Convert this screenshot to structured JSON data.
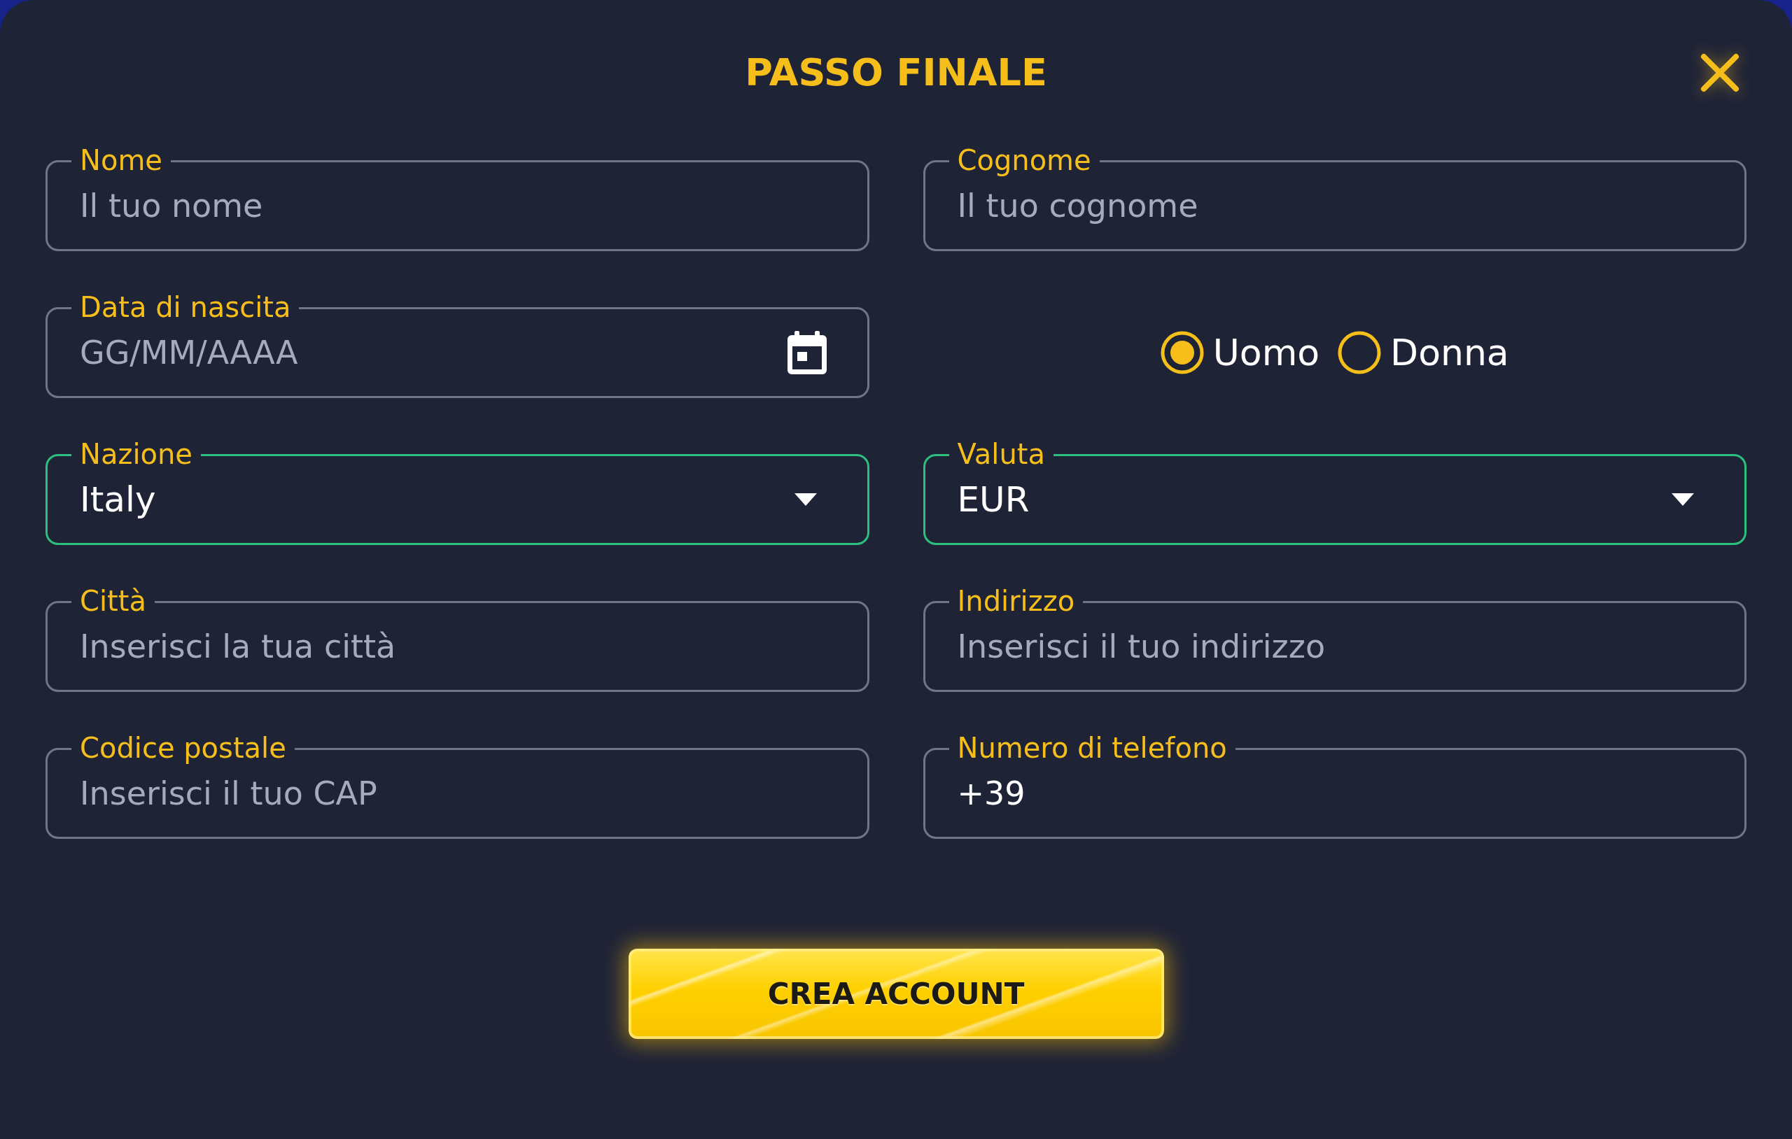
{
  "dialog": {
    "title": "PASSO FINALE"
  },
  "fields": [
    {
      "kind": "text",
      "label": "Nome",
      "placeholder": "Il tuo nome",
      "valid": false
    },
    {
      "kind": "text",
      "label": "Cognome",
      "placeholder": "Il tuo cognome",
      "valid": false
    },
    {
      "kind": "date",
      "label": "Data di nascita",
      "placeholder": "GG/MM/AAAA",
      "valid": false
    },
    {
      "kind": "radio",
      "options": [
        {
          "label": "Uomo",
          "selected": true
        },
        {
          "label": "Donna",
          "selected": false
        }
      ]
    },
    {
      "kind": "select",
      "label": "Nazione",
      "value": "Italy",
      "valid": true
    },
    {
      "kind": "select",
      "label": "Valuta",
      "value": "EUR",
      "valid": true
    },
    {
      "kind": "text",
      "label": "Città",
      "placeholder": "Inserisci la tua città",
      "valid": false
    },
    {
      "kind": "text",
      "label": "Indirizzo",
      "placeholder": "Inserisci il tuo indirizzo",
      "valid": false
    },
    {
      "kind": "text",
      "label": "Codice postale",
      "placeholder": "Inserisci il tuo CAP",
      "valid": false
    },
    {
      "kind": "text",
      "label": "Numero di telefono",
      "value": "+39",
      "valid": false
    }
  ],
  "submit_button": {
    "label": "CREA ACCOUNT"
  }
}
